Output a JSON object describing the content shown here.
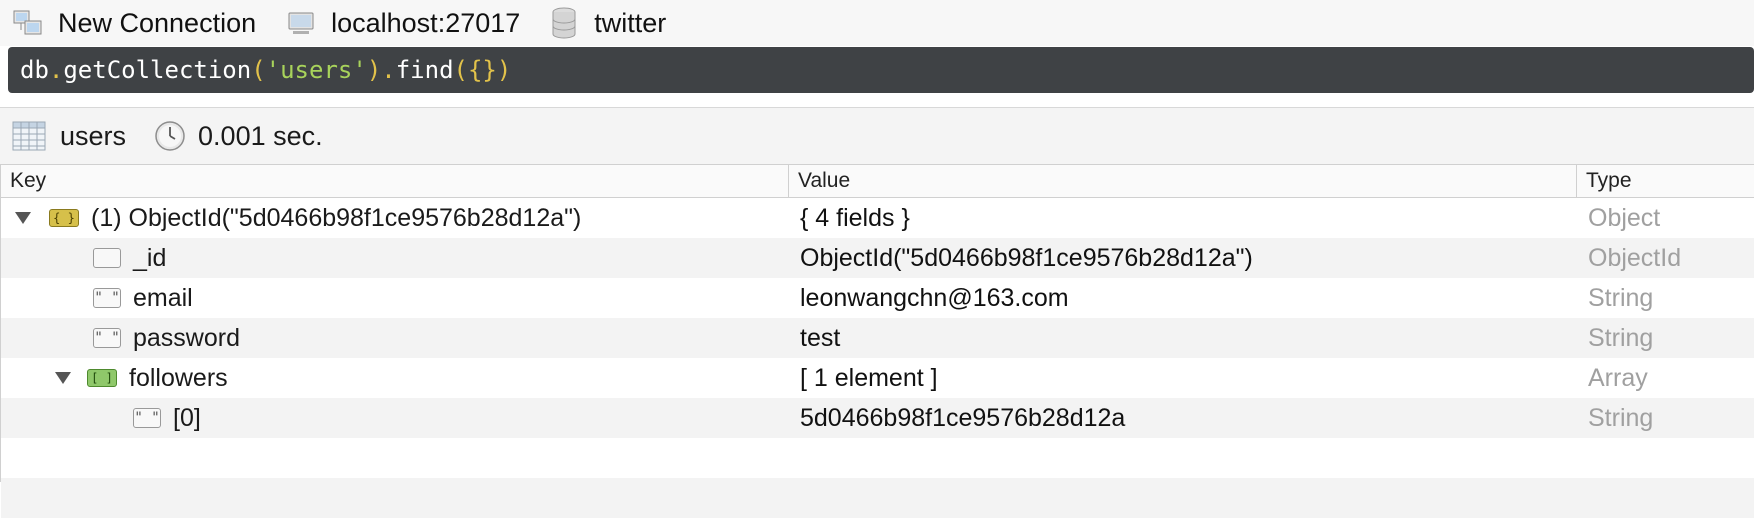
{
  "breadcrumb": {
    "connection": "New Connection",
    "server": "localhost:27017",
    "database": "twitter"
  },
  "query": {
    "db": "db",
    "dot1": ".",
    "method1": "getCollection",
    "paren_open": "(",
    "collection_literal": "'users'",
    "paren_close": ")",
    "dot2": ".",
    "method2": "find",
    "args": "({})"
  },
  "result": {
    "collection": "users",
    "time": "0.001 sec."
  },
  "table": {
    "headers": {
      "key": "Key",
      "value": "Value",
      "type": "Type"
    },
    "rows": [
      {
        "key": "(1) ObjectId(\"5d0466b98f1ce9576b28d12a\")",
        "value": "{ 4 fields }",
        "type": "Object",
        "icon": "object-icon"
      },
      {
        "key": "_id",
        "value": "ObjectId(\"5d0466b98f1ce9576b28d12a\")",
        "type": "ObjectId",
        "icon": "objectid-icon"
      },
      {
        "key": "email",
        "value": "leonwangchn@163.com",
        "type": "String",
        "icon": "string-icon"
      },
      {
        "key": "password",
        "value": "test",
        "type": "String",
        "icon": "string-icon"
      },
      {
        "key": "followers",
        "value": "[ 1 element ]",
        "type": "Array",
        "icon": "array-icon"
      },
      {
        "key": "[0]",
        "value": "5d0466b98f1ce9576b28d12a",
        "type": "String",
        "icon": "string-icon"
      }
    ]
  },
  "icons": {
    "object_glyph": "{ }",
    "array_glyph": "[ ]",
    "string_glyph": "\" \""
  },
  "colors": {
    "query_bg": "#3f4245",
    "query_method": "#ffffff",
    "query_punct": "#e2c24a",
    "query_string": "#a8d35b",
    "type_text": "#a0a0a0"
  }
}
